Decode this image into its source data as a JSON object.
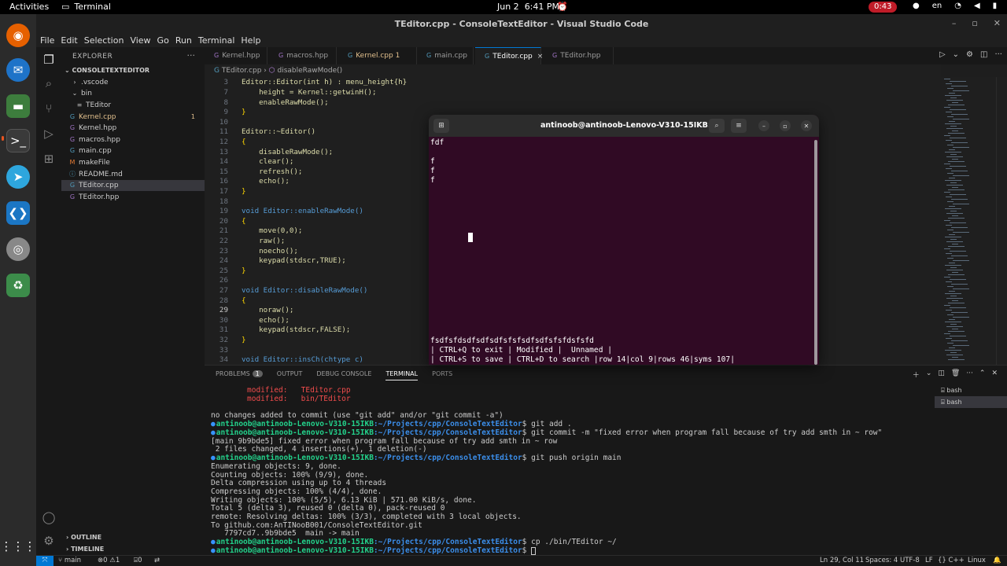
{
  "topbar": {
    "activities": "Activities",
    "app_name": "Terminal",
    "date": "Jun 2",
    "time": "6:41 PM",
    "recording": "0:43",
    "lang": "en"
  },
  "window": {
    "title": "TEditor.cpp - ConsoleTextEditor - Visual Studio Code"
  },
  "menu": [
    "File",
    "Edit",
    "Selection",
    "View",
    "Go",
    "Run",
    "Terminal",
    "Help"
  ],
  "explorer": {
    "title": "EXPLORER",
    "project": "CONSOLETEXTEDITOR",
    "items": [
      {
        "label": ".vscode",
        "kind": "folder",
        "open": false
      },
      {
        "label": "bin",
        "kind": "folder",
        "open": true
      },
      {
        "label": "TEditor",
        "kind": "file"
      },
      {
        "label": "Kernel.cpp",
        "kind": "cpp",
        "badge": "1"
      },
      {
        "label": "Kernel.hpp",
        "kind": "hpp"
      },
      {
        "label": "macros.hpp",
        "kind": "hpp"
      },
      {
        "label": "main.cpp",
        "kind": "cpp"
      },
      {
        "label": "makeFile",
        "kind": "make"
      },
      {
        "label": "README.md",
        "kind": "md"
      },
      {
        "label": "TEditor.cpp",
        "kind": "cpp"
      },
      {
        "label": "TEditor.hpp",
        "kind": "hpp"
      }
    ],
    "outline": "OUTLINE",
    "timeline": "TIMELINE"
  },
  "tabs": [
    {
      "label": "Kernel.hpp"
    },
    {
      "label": "macros.hpp"
    },
    {
      "label": "Kernel.cpp",
      "badge": "1"
    },
    {
      "label": "main.cpp"
    },
    {
      "label": "TEditor.cpp",
      "close": "×"
    },
    {
      "label": "TEditor.hpp"
    }
  ],
  "breadcrumb": {
    "file": "TEditor.cpp",
    "sep": "›",
    "symbol": "disableRawMode()"
  },
  "code": {
    "line3": "Editor::Editor(int h) : menu_height{h}",
    "lines": [
      {
        "n": "7",
        "text": "    height = Kernel::getwinH();"
      },
      {
        "n": "8",
        "text": "    enableRawMode();"
      },
      {
        "n": "9",
        "text": "}"
      },
      {
        "n": "10",
        "text": ""
      },
      {
        "n": "11",
        "text": "Editor::~Editor()"
      },
      {
        "n": "12",
        "text": "{"
      },
      {
        "n": "13",
        "text": "    disableRawMode();"
      },
      {
        "n": "14",
        "text": "    clear();"
      },
      {
        "n": "15",
        "text": "    refresh();"
      },
      {
        "n": "16",
        "text": "    echo();"
      },
      {
        "n": "17",
        "text": "}"
      },
      {
        "n": "18",
        "text": ""
      },
      {
        "n": "19",
        "text": "void Editor::enableRawMode()"
      },
      {
        "n": "20",
        "text": "{"
      },
      {
        "n": "21",
        "text": "    move(0,0);"
      },
      {
        "n": "22",
        "text": "    raw();"
      },
      {
        "n": "23",
        "text": "    noecho();"
      },
      {
        "n": "24",
        "text": "    keypad(stdscr,TRUE);"
      },
      {
        "n": "25",
        "text": "}"
      },
      {
        "n": "26",
        "text": ""
      },
      {
        "n": "27",
        "text": "void Editor::disableRawMode()"
      },
      {
        "n": "28",
        "text": "{"
      },
      {
        "n": "29",
        "text": "    noraw();"
      },
      {
        "n": "30",
        "text": "    echo();"
      },
      {
        "n": "31",
        "text": "    keypad(stdscr,FALSE);"
      },
      {
        "n": "32",
        "text": "}"
      },
      {
        "n": "33",
        "text": ""
      },
      {
        "n": "34",
        "text": "void Editor::insCh(chtype c)"
      }
    ]
  },
  "panel": {
    "tabs": [
      "PROBLEMS",
      "OUTPUT",
      "DEBUG CONSOLE",
      "TERMINAL",
      "PORTS"
    ],
    "problems_count": "1",
    "terminals": [
      "bash",
      "bash"
    ]
  },
  "terminal_out": {
    "modified1": "modified:   TEditor.cpp",
    "modified2": "modified:   bin/TEditor",
    "nochanges": "no changes added to commit (use \"git add\" and/or \"git commit -a\")",
    "prompt": "antinoob@antinoob-Lenovo-V310-15IKB",
    "path": ":~/Projects/cpp/ConsoleTextEditor",
    "cmd1": "$ git add .",
    "cmd2": "$ git commit -m \"fixed error when program fall because of try add smth in ~ row\"",
    "out_commit1": "[main 9b9bde5] fixed error when program fall because of try add smth in ~ row",
    "out_commit2": " 2 files changed, 4 insertions(+), 1 deletion(-)",
    "cmd3": "$ git push origin main",
    "push": [
      "Enumerating objects: 9, done.",
      "Counting objects: 100% (9/9), done.",
      "Delta compression using up to 4 threads",
      "Compressing objects: 100% (4/4), done.",
      "Writing objects: 100% (5/5), 6.13 KiB | 571.00 KiB/s, done.",
      "Total 5 (delta 3), reused 0 (delta 0), pack-reused 0",
      "remote: Resolving deltas: 100% (3/3), completed with 3 local objects.",
      "To github.com:AnTINooB001/ConsoleTextEditor.git",
      "   7797cd7..9b9bde5  main -> main"
    ],
    "cmd4": "$ cp ./bin/TEditor ~/",
    "cmd5": "$ "
  },
  "gterm": {
    "title": "antinoob@antinoob-Lenovo-V310-15IKB: ~",
    "lines": [
      "fdf",
      "",
      "f",
      "f",
      "f"
    ],
    "bottom1": "fsdfsfdsdfsdfsdfsfsfsdfsdfsfsfdsfsfd",
    "bottom2": "| CTRL+Q to exit | Modified |  Unnamed |",
    "bottom3": "| CTRL+S to save | CTRL+D to search |row 14|col 9|rows 46|syms 107|"
  },
  "status": {
    "branch": "main",
    "errors": "0",
    "warnings": "1",
    "ports": "0",
    "position": "Ln 29, Col 11",
    "spaces": "Spaces: 4",
    "encoding": "UTF-8",
    "eol": "LF",
    "lang": "C++",
    "os": "Linux"
  },
  "colors": {
    "accent": "#0078d4",
    "terminal_bg": "#300a24",
    "ubuntu_orange": "#e95420"
  }
}
